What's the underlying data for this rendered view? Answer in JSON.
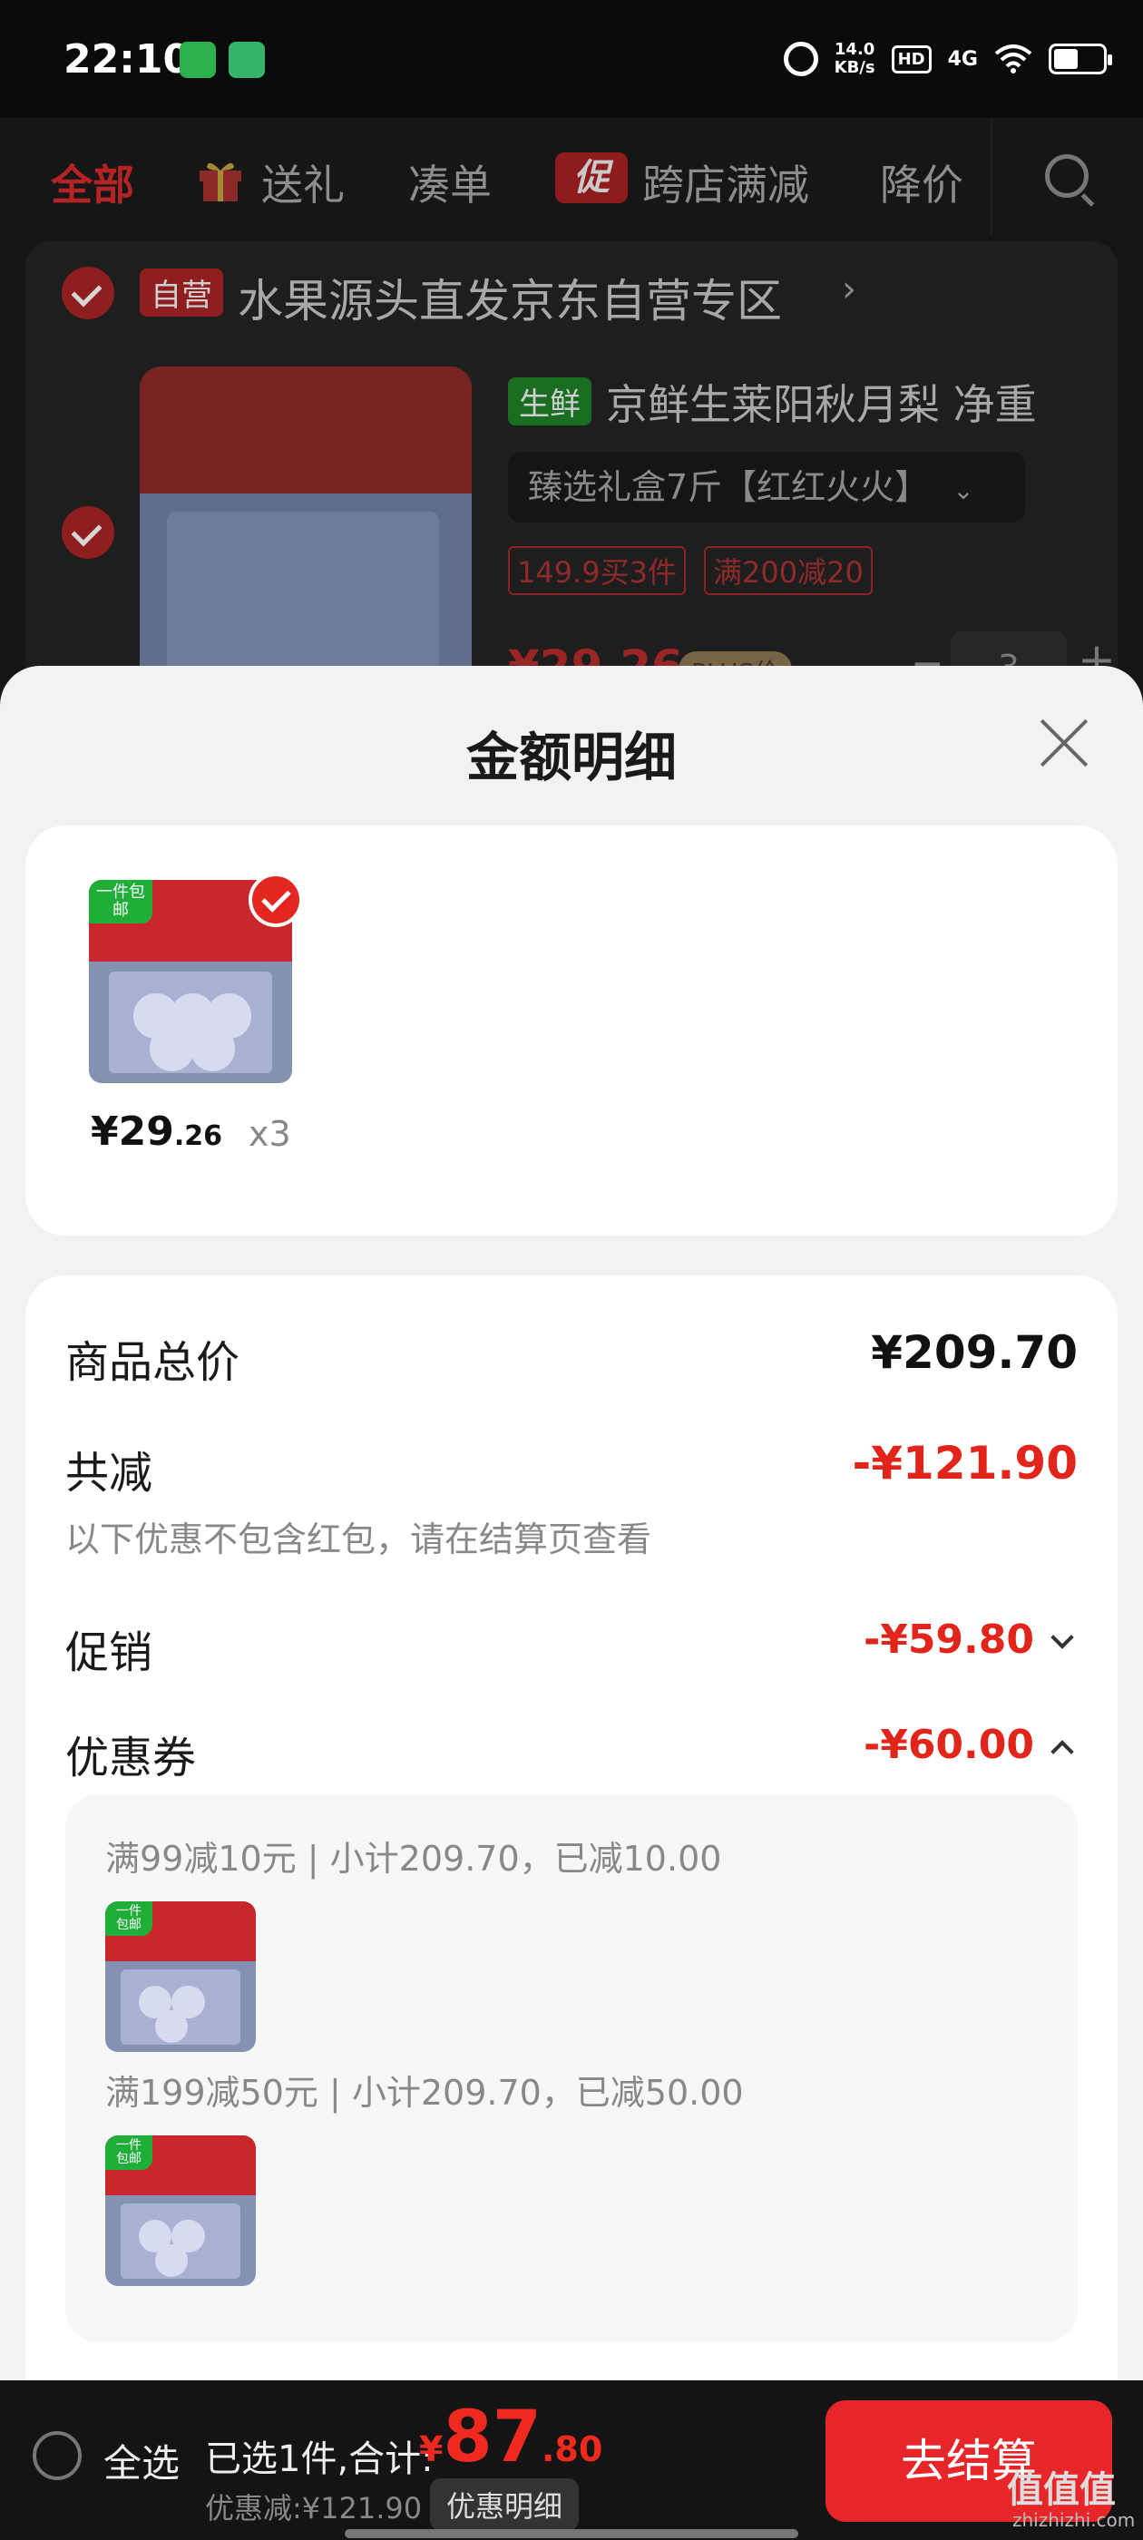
{
  "status_bar": {
    "time": "22:10",
    "speed_value": "14.0",
    "speed_unit": "KB/s",
    "hd": "HD",
    "network": "4G",
    "icons": [
      "wechat-icon",
      "app-icon",
      "alarm-icon",
      "wifi-icon",
      "battery-icon"
    ]
  },
  "tabs": [
    {
      "label": "全部",
      "active": true
    },
    {
      "label": "送礼",
      "icon": "gift-icon"
    },
    {
      "label": "凑单"
    },
    {
      "label": "跨店满减",
      "badge": "促"
    },
    {
      "label": "降价"
    }
  ],
  "store": {
    "tag": "自营",
    "name": "水果源头直发京东自营专区",
    "arrow": "›"
  },
  "product": {
    "tag": "生鲜",
    "title": "京鲜生莱阳秋月梨 净重",
    "spec": "臻选礼盒7斤【红红火火】",
    "promos": [
      "149.9买3件",
      "满200减20"
    ],
    "price": "¥29.26",
    "plus_tag": "PLUS价",
    "quantity": "3",
    "minus": "−",
    "plus": "+"
  },
  "sheet": {
    "title": "金额明细",
    "item": {
      "badge": "一件包邮",
      "price_int": "¥29",
      "price_dec": ".26",
      "qty": "x3"
    },
    "rows": {
      "total_label": "商品总价",
      "total_value": "¥209.70",
      "reduce_label": "共减",
      "reduce_value": "-¥121.90",
      "reduce_note": "以下优惠不包含红包，请在结算页查看",
      "promo_label": "促销",
      "promo_value": "-¥59.80",
      "coupon_label": "优惠券",
      "coupon_value": "-¥60.00"
    },
    "coupons": [
      {
        "text": "满99减10元 | 小计209.70，已减10.00"
      },
      {
        "text": "满199减50元 | 小计209.70，已减50.00"
      }
    ]
  },
  "bottom_bar": {
    "select_all": "全选",
    "selected": "已选1件,合计:",
    "total_currency": "¥",
    "total_int": "87",
    "total_dec": ".80",
    "discount": "优惠减:¥121.90",
    "detail_button": "优惠明细",
    "checkout": "去结算"
  },
  "watermark": {
    "main": "值值值",
    "sub": "zhizhizhi.com"
  },
  "colors": {
    "accent_red": "#e1251b",
    "fresh_green": "#1fae38",
    "sheet_bg": "#f2f2f2"
  }
}
